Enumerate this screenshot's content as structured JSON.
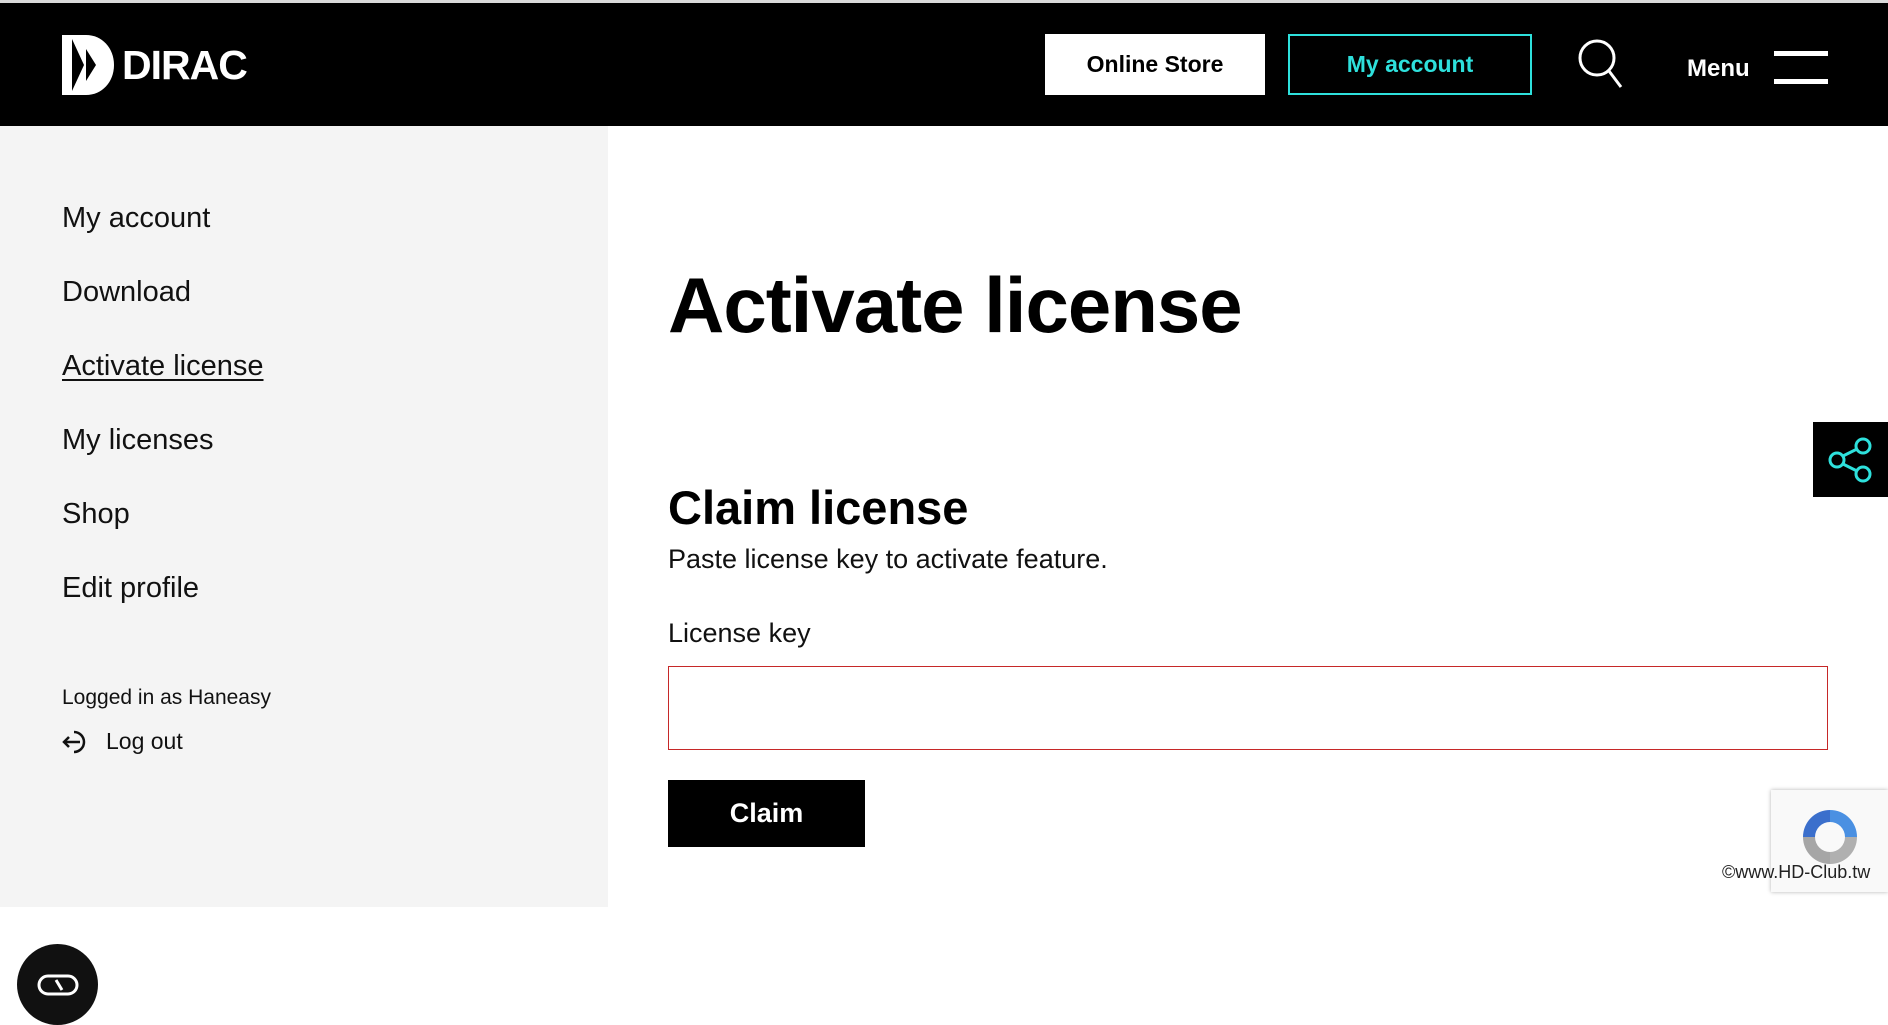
{
  "header": {
    "logo_text": "DIRAC",
    "online_store_label": "Online Store",
    "my_account_label": "My account",
    "menu_label": "Menu",
    "accent_color": "#2ee0dc"
  },
  "sidebar": {
    "items": [
      {
        "label": "My account"
      },
      {
        "label": "Download"
      },
      {
        "label": "Activate license",
        "active": true
      },
      {
        "label": "My licenses"
      },
      {
        "label": "Shop"
      },
      {
        "label": "Edit profile"
      }
    ],
    "logged_in_text": "Logged in as Haneasy",
    "logout_label": "Log out"
  },
  "main": {
    "title": "Activate license",
    "section_title": "Claim license",
    "section_subtitle": "Paste license key to activate feature.",
    "field_label": "License key",
    "field_value": "",
    "claim_label": "Claim"
  },
  "overlay": {
    "watermark": "©www.HD-Club.tw"
  },
  "icons": [
    "dirac-logo-icon",
    "search-icon",
    "menu-icon",
    "share-icon",
    "logout-icon",
    "chat-icon",
    "recaptcha-icon"
  ]
}
